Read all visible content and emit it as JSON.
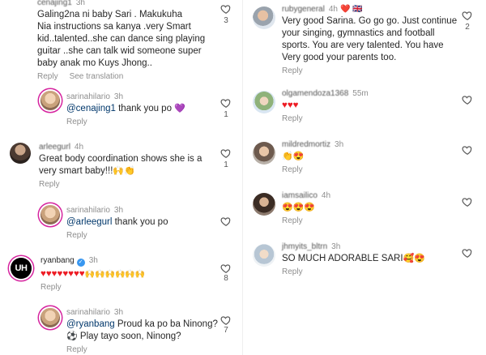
{
  "left": {
    "c1": {
      "username": "cenajing1",
      "time": "3h",
      "lines": [
        "Galing2na ni baby Sari . Makukuha",
        "Nia instructions sa kanya .very Smart",
        "kid..talented..she can dance sing playing",
        "guitar ..she can talk wid someone  super",
        "baby  anak mo Kuys  Jhong.."
      ],
      "reply": "Reply",
      "see_translation": "See translation",
      "likes": "3"
    },
    "r1": {
      "username": "sarinahilario",
      "time": "3h",
      "mention": "@cenajing1",
      "text": " thank you po ",
      "emoji": "💜",
      "reply": "Reply",
      "likes": "1"
    },
    "c2": {
      "username": "arleegurl",
      "time": "4h",
      "lines": [
        "Great body coordination shows she is a",
        "very smart baby!!!"
      ],
      "emoji": "🙌👏",
      "reply": "Reply",
      "likes": "1"
    },
    "r2": {
      "username": "sarinahilario",
      "time": "3h",
      "mention": "@arleegurl",
      "text": " thank you po",
      "reply": "Reply"
    },
    "c3": {
      "username": "ryanbang",
      "avatar_text": "UH",
      "time": "3h",
      "hearts": "♥♥♥♥♥♥♥♥",
      "hands": "🙌🙌🙌🙌🙌🙌",
      "reply": "Reply",
      "likes": "8"
    },
    "r3": {
      "username": "sarinahilario",
      "time": "3h",
      "mention": "@ryanbang",
      "text": " Proud ka po ba Ninong?",
      "line2_emoji": "⚽",
      "line2": " Play tayo soon, Ninong?",
      "reply": "Reply",
      "likes": "7"
    }
  },
  "right": {
    "c1": {
      "username": "rubygeneral",
      "time": "4h",
      "badges": "❤️ 🇬🇧",
      "lines": [
        "Very good Sarina. Go go go. Just continue",
        "your singing, gymnastics and football",
        "sports.  You are very talented. You have",
        "Very good your parents too."
      ],
      "reply": "Reply",
      "likes": "2"
    },
    "c2": {
      "username": "olgamendoza1368",
      "time": "55m",
      "hearts": "♥♥♥",
      "reply": "Reply"
    },
    "c3": {
      "username": "mildredmortiz",
      "time": "3h",
      "emoji": "👏😍",
      "reply": "Reply"
    },
    "c4": {
      "username": "iamsailico",
      "time": "4h",
      "emoji": "😍😍😍",
      "reply": "Reply"
    },
    "c5": {
      "username": "jhmyits_bltrn",
      "time": "3h",
      "text": "SO MUCH ADORABLE SARI",
      "emoji": "🥰😍",
      "reply": "Reply"
    }
  },
  "icons": {
    "heart": "heart-outline-icon",
    "verified": "verified-badge-icon"
  },
  "colors": {
    "text": "#262626",
    "muted": "#8e8e8e",
    "mention": "#00376b",
    "heart": "#ed1c24",
    "ring": "#d6249f",
    "verified": "#3897f0"
  }
}
